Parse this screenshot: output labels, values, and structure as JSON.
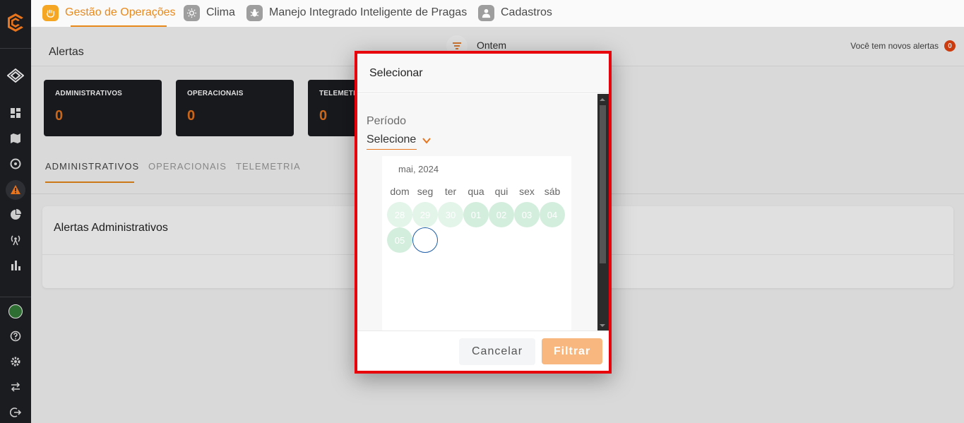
{
  "topnav": {
    "items": [
      {
        "label": "Gestão de Operações",
        "icon": "hand-icon",
        "active": true
      },
      {
        "label": "Clima",
        "icon": "sun-icon"
      },
      {
        "label": "Manejo Integrado Inteligente de Pragas",
        "icon": "bug-icon"
      },
      {
        "label": "Cadastros",
        "icon": "user-icon"
      }
    ]
  },
  "header": {
    "title": "Alertas",
    "filter_label": "Ontem",
    "alert_note": "Você tem novos alertas",
    "alert_count": "0"
  },
  "cards": [
    {
      "label": "ADMINISTRATIVOS",
      "value": "0"
    },
    {
      "label": "OPERACIONAIS",
      "value": "0"
    },
    {
      "label": "TELEMETRIA",
      "value": "0"
    }
  ],
  "tabs": [
    "ADMINISTRATIVOS",
    "OPERACIONAIS",
    "TELEMETRIA"
  ],
  "panel": {
    "title": "Alertas Administrativos"
  },
  "dialog": {
    "title": "Selecionar",
    "period_label": "Período",
    "period_value": "Selecione",
    "calendar": {
      "month": "mai, 2024",
      "weekdays": [
        "dom",
        "seg",
        "ter",
        "qua",
        "qui",
        "sex",
        "sáb"
      ],
      "row1": [
        "28",
        "29",
        "30",
        "01",
        "02",
        "03",
        "04"
      ],
      "row2": [
        "05",
        ""
      ]
    },
    "cancel_label": "Cancelar",
    "filter_label": "Filtrar"
  },
  "colors": {
    "accent": "#e8741c",
    "highlight": "#e8000b"
  }
}
